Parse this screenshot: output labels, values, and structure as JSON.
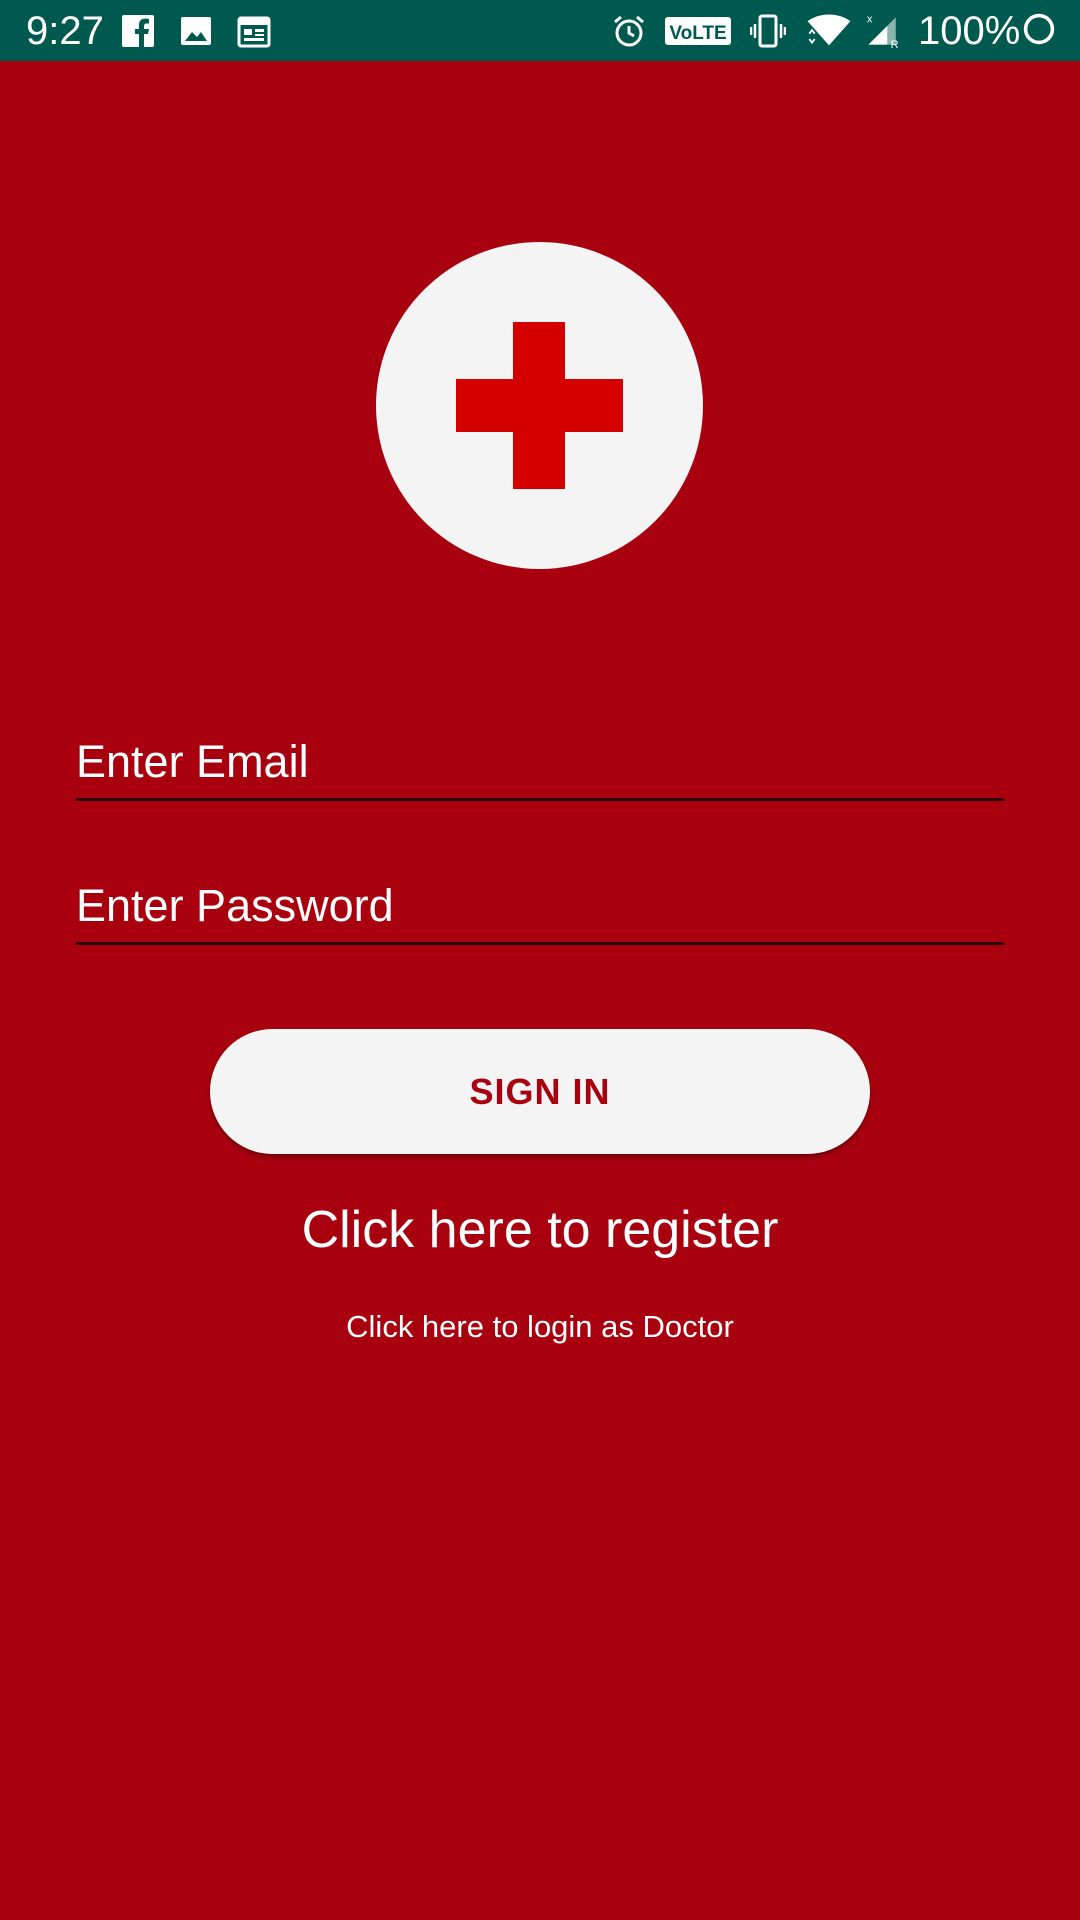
{
  "status_bar": {
    "time": "9:27",
    "battery_percent": "100%",
    "icons": [
      "facebook-icon",
      "image-icon",
      "calendar-icon",
      "alarm-icon",
      "volte-icon",
      "vibrate-icon",
      "wifi-icon",
      "signal-icon",
      "battery-icon"
    ],
    "volte_label": "VoLTE"
  },
  "logo": {
    "icon": "medical-cross-icon",
    "circle_color": "#f4f4f4",
    "cross_color": "#d40000"
  },
  "form": {
    "email_placeholder": "Enter Email",
    "email_value": "",
    "password_placeholder": "Enter Password",
    "password_value": "",
    "signin_label": "SIGN IN"
  },
  "links": {
    "register": "Click here to register",
    "doctor_login": "Click here to login as Doctor"
  },
  "colors": {
    "background": "#a8000e",
    "status_bar": "#00594f",
    "button": "#f4f4f4",
    "button_text": "#a8000e"
  }
}
